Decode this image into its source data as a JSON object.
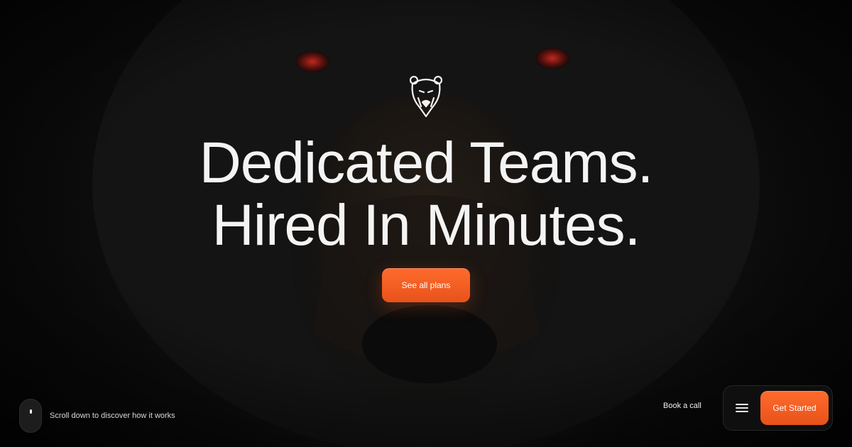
{
  "hero": {
    "headline_line1": "Dedicated Teams.",
    "headline_line2": "Hired In Minutes.",
    "cta_label": "See all plans"
  },
  "scroll_hint": {
    "text": "Scroll down to discover how it works"
  },
  "nav": {
    "book_call_label": "Book a call",
    "get_started_label": "Get Started"
  },
  "icons": {
    "logo": "bear-head-logo-icon",
    "menu": "hamburger-menu-icon",
    "scroll": "mouse-scroll-icon"
  },
  "colors": {
    "background": "#0a0a0a",
    "accent": "#f0602a",
    "text": "#f4f4f4",
    "eye": "#b3261e"
  }
}
